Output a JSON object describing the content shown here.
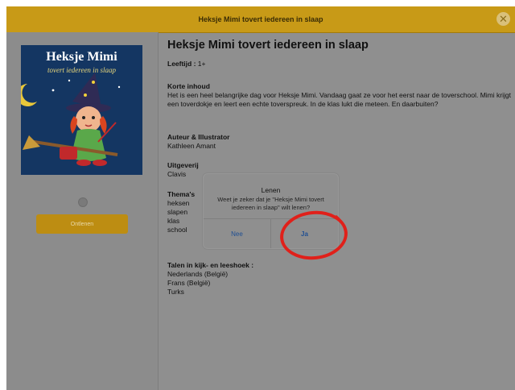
{
  "header": {
    "title": "Heksje Mimi tovert iedereen in slaap",
    "close_icon": "close-icon"
  },
  "book": {
    "cover_title": "Heksje Mimi",
    "cover_subtitle": "tovert iedereen in slaap",
    "borrow_label": "Ontlenen"
  },
  "details": {
    "heading": "Heksje Mimi tovert iedereen in slaap",
    "age_label": "Leeftijd :",
    "age_value": "1+",
    "summary_label": "Korte inhoud",
    "summary_text": "Het is een heel belangrijke dag voor Heksje Mimi. Vandaag gaat ze voor het eerst naar de toverschool. Mimi krijgt een toverdokje en leert een echte toverspreuk. In de klas lukt die meteen. En daarbuiten?",
    "author_label": "Auteur & Illustrator",
    "author_value": "Kathleen Amant",
    "publisher_label": "Uitgeverij",
    "publisher_value": "Clavis",
    "themes_label": "Thema's",
    "themes": [
      "heksen",
      "slapen",
      "klas",
      "school"
    ],
    "languages_label": "Talen in kijk- en leeshoek :",
    "languages": [
      "Nederlands (België)",
      "Frans (België)",
      "Turks"
    ]
  },
  "dialog": {
    "title": "Lenen",
    "message": "Weet je zeker dat je \"Heksje Mimi tovert iedereen in slaap\" wilt lenen?",
    "no_label": "Nee",
    "yes_label": "Ja"
  },
  "colors": {
    "accent": "#c89a17",
    "dim_overlay": "#8f8f8f",
    "highlight_circle": "#e0201a",
    "dialog_button_text": "#1f4f93"
  }
}
